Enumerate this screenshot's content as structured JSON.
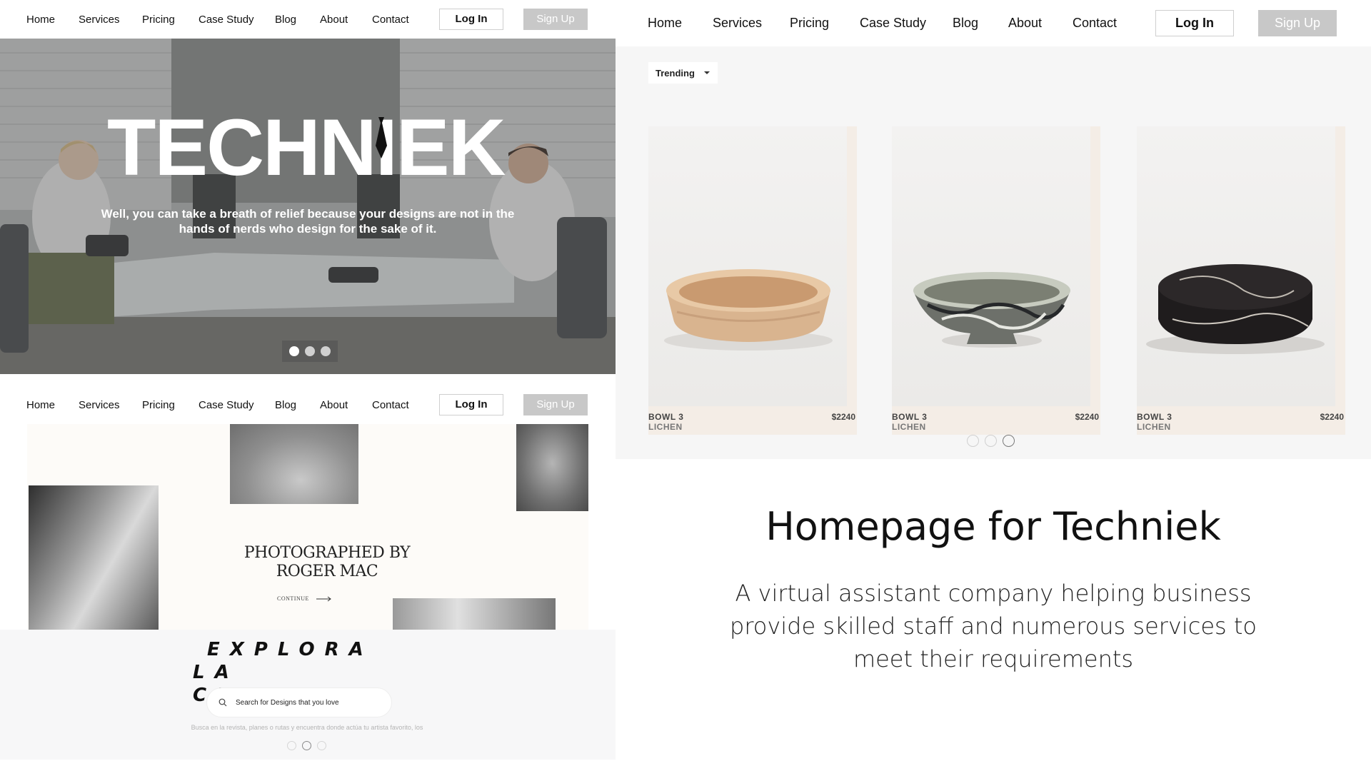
{
  "nav": {
    "links": [
      "Home",
      "Services",
      "Pricing",
      "Case Study",
      "Blog",
      "About",
      "Contact"
    ],
    "login_label": "Log In",
    "signup_label": "Sign Up"
  },
  "hero": {
    "title": "TECHNIEK",
    "subtitle": "Well, you can take a breath of relief because your designs are not in the hands of nerds who design for the sake of it.",
    "active_slide": 1,
    "slide_count": 3
  },
  "gallery": {
    "heading_line1": "PHOTOGRAPHED BY",
    "heading_line2": "ROGER MAC",
    "continue_label": "CONTINUE"
  },
  "explora": {
    "title_line1": "EXPLORA",
    "title_line2": "LA CIUDAD",
    "search_placeholder": "Search for Designs that you love",
    "caption": "Busca en la revista, planes o rutas y encuentra donde actúa tu artista favorito, los",
    "active_slide": 2,
    "slide_count": 3
  },
  "products": {
    "filter_label": "Trending",
    "items": [
      {
        "name": "BOWL 3",
        "subtitle": "LICHEN",
        "price": "$2240"
      },
      {
        "name": "BOWL 3",
        "subtitle": "LICHEN",
        "price": "$2240"
      },
      {
        "name": "BOWL 3",
        "subtitle": "LICHEN",
        "price": "$2240"
      }
    ],
    "active_slide": 3,
    "slide_count": 3
  },
  "info": {
    "headline": "Homepage for Techniek",
    "description": "A virtual assistant company helping business provide skilled staff and numerous services to meet their requirements"
  },
  "colors": {
    "signup_bg": "#c8c8c8",
    "panel_bg": "#f6f6f6",
    "card_bg": "#f4ede6",
    "gallery_bg": "#fdfbf8"
  }
}
